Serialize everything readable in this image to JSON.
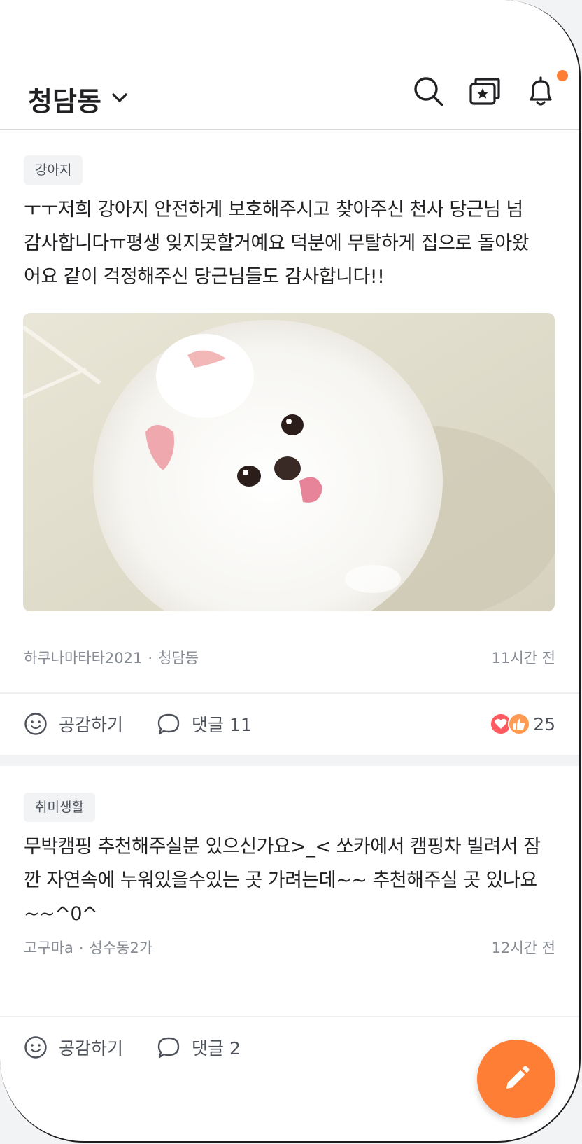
{
  "header": {
    "location": "청담동",
    "icons": [
      "search-icon",
      "category-icon",
      "bell-icon"
    ]
  },
  "posts": [
    {
      "category": "강아지",
      "text": "ㅜㅜ저희 강아지 안전하게 보호해주시고 찾아주신 천사 당근님 넘 감사합니다ㅠ평생 잊지못할거예요 덕분에 무탈하게 집으로 돌아왔어요 같이 걱정해주신 당근님들도 감사합니다!!",
      "author": "하쿠나마타타2021",
      "region": "청담동",
      "time": "11시간 전",
      "like_label": "공감하기",
      "comment_label": "댓글 11",
      "reaction_count": "25",
      "has_image": true
    },
    {
      "category": "취미생활",
      "text": "무박캠핑 추천해주실분 있으신가요>_< 쏘카에서 캠핑차 빌려서 잠깐 자연속에 누워있을수있는 곳 가려는데~~ 추천해주실 곳 있나요~~^0^",
      "author": "고구마a",
      "region": "성수동2가",
      "time": "12시간 전",
      "like_label": "공감하기",
      "comment_label": "댓글 2"
    }
  ],
  "meta_separator": "·",
  "colors": {
    "accent": "#ff7e36",
    "text": "#212124",
    "muted": "#868b94",
    "heart": "#ff5a5f"
  }
}
